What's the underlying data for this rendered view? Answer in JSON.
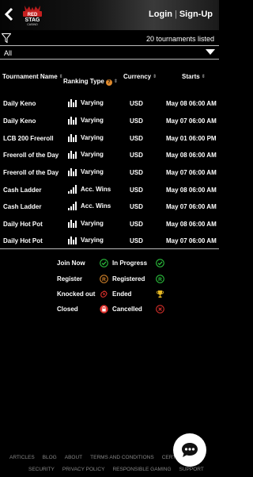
{
  "header": {
    "login_label": "Login",
    "signup_label": "Sign-Up",
    "logo_text_top": "RED",
    "logo_text_mid": "STAG",
    "logo_text_bot": "CASINO"
  },
  "filter": {
    "count_text": "20 tournaments listed",
    "selected_value": "All"
  },
  "table": {
    "headers": {
      "name": "Tournament Name",
      "type": "Ranking Type",
      "currency": "Currency",
      "starts": "Starts"
    },
    "rows": [
      {
        "name": "Daily Keno",
        "type": "Varying",
        "type_icon": "bars-varying-icon",
        "currency": "USD",
        "starts": "May 08 06:00 AM"
      },
      {
        "name": "Daily Keno",
        "type": "Varying",
        "type_icon": "bars-varying-icon",
        "currency": "USD",
        "starts": "May 07 06:00 AM"
      },
      {
        "name": "LCB 200 Freeroll",
        "type": "Varying",
        "type_icon": "bars-varying-icon",
        "currency": "USD",
        "starts": "May 01 06:00 PM"
      },
      {
        "name": "Freeroll of the Day",
        "type": "Varying",
        "type_icon": "bars-varying-icon",
        "currency": "USD",
        "starts": "May 08 06:00 AM"
      },
      {
        "name": "Freeroll of the Day",
        "type": "Varying",
        "type_icon": "bars-varying-icon",
        "currency": "USD",
        "starts": "May 07 06:00 AM"
      },
      {
        "name": "Cash Ladder",
        "type": "Acc. Wins",
        "type_icon": "bars-ascending-icon",
        "currency": "USD",
        "starts": "May 08 06:00 AM"
      },
      {
        "name": "Cash Ladder",
        "type": "Acc. Wins",
        "type_icon": "bars-ascending-icon",
        "currency": "USD",
        "starts": "May 07 06:00 AM"
      },
      {
        "name": "Daily Hot Pot",
        "type": "Varying",
        "type_icon": "bars-varying-icon",
        "currency": "USD",
        "starts": "May 08 06:00 AM"
      },
      {
        "name": "Daily Hot Pot",
        "type": "Varying",
        "type_icon": "bars-varying-icon",
        "currency": "USD",
        "starts": "May 07 06:00 AM"
      }
    ]
  },
  "legend": {
    "join_now": "Join Now",
    "in_progress": "In Progress",
    "register": "Register",
    "registered": "Registered",
    "knocked_out": "Knocked out",
    "ended": "Ended",
    "closed": "Closed",
    "cancelled": "Cancelled",
    "register_icon_letter": "R",
    "registered_icon_letter": "R"
  },
  "footer": {
    "links_row1": [
      "ARTICLES",
      "BLOG",
      "ABOUT",
      "TERMS AND CONDITIONS",
      "CERTIFIED"
    ],
    "links_row2": [
      "SECURITY",
      "PRIVACY POLICY",
      "RESPONSIBLE GAMING",
      "SUPPORT"
    ]
  },
  "colors": {
    "green": "#2ecc40",
    "orange": "#e08a2c",
    "red": "#e0312c",
    "gold": "#e8b923"
  }
}
